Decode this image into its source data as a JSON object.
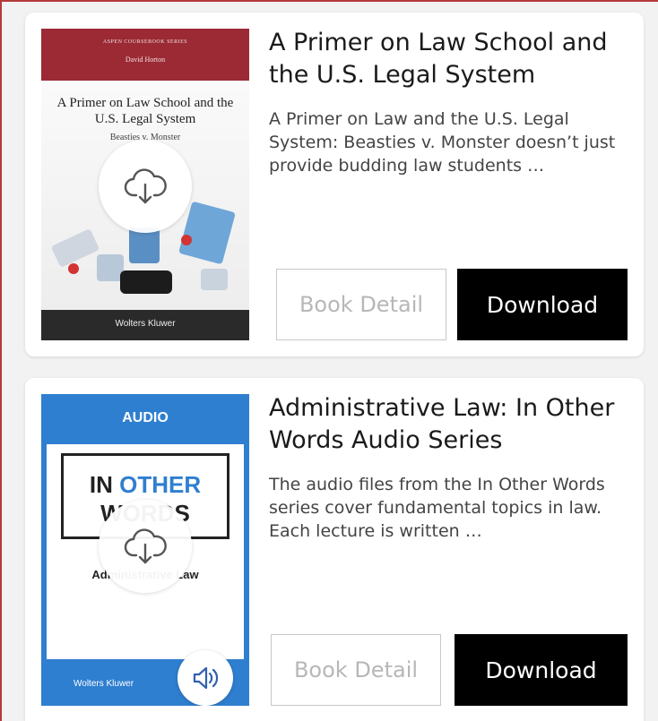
{
  "books": [
    {
      "title": "A Primer on Law School and the U.S. Legal System",
      "description": "A Primer on Law and the U.S. Legal System: Beasties v. Monster doesn’t just provide budding law students …",
      "cover": {
        "series": "ASPEN COURSEBOOK SERIES",
        "author": "David Horton",
        "title": "A Primer on Law School and the U.S. Legal System",
        "subtitle": "Beasties v. Monster",
        "publisher": "Wolters Kluwer"
      },
      "detail_label": "Book Detail",
      "download_label": "Download"
    },
    {
      "title": "Administrative Law: In Other Words Audio Series",
      "description": "The audio files from the In Other Words series cover fundamental topics in law. Each lecture is written …",
      "cover": {
        "badge": "AUDIO",
        "line1a": "IN",
        "line1b": "OTHER",
        "line2": "WORDS",
        "subject": "Administrative Law",
        "publisher": "Wolters Kluwer"
      },
      "detail_label": "Book Detail",
      "download_label": "Download"
    }
  ],
  "colors": {
    "accent_frame": "#b33a3a",
    "cover1_band": "#9b2a35",
    "cover2_blue": "#2f7fd0",
    "download_bg": "#000000"
  },
  "icons": [
    "cloud-download-icon",
    "audio-speaker-icon"
  ]
}
